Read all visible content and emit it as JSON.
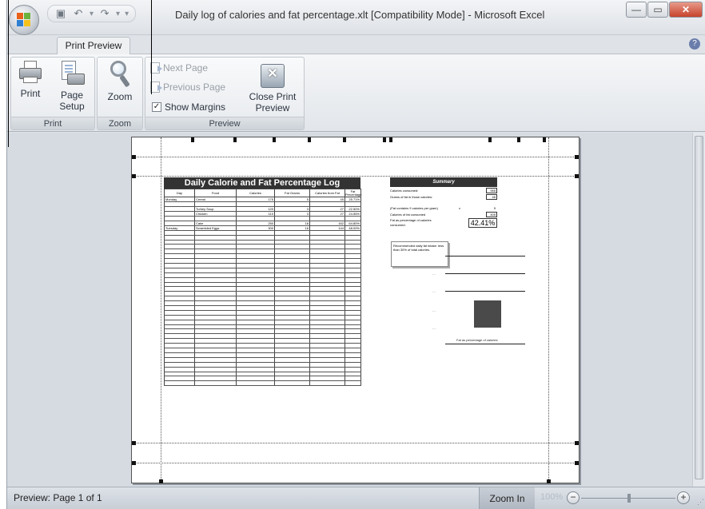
{
  "window": {
    "title": "Daily log of calories and fat percentage.xlt  [Compatibility Mode] - Microsoft Excel"
  },
  "ribbon": {
    "active_tab": "Print Preview",
    "groups": {
      "print": {
        "label": "Print",
        "print_label": "Print",
        "page_setup_line1": "Page",
        "page_setup_line2": "Setup"
      },
      "zoom": {
        "label": "Zoom",
        "zoom_label": "Zoom"
      },
      "preview": {
        "label": "Preview",
        "next_page": "Next Page",
        "previous_page": "Previous Page",
        "show_margins": "Show Margins",
        "show_margins_checked": true,
        "close_line1": "Close Print",
        "close_line2": "Preview"
      }
    }
  },
  "sheet": {
    "log_title": "Daily Calorie and Fat Percentage Log",
    "headers": [
      "Day",
      "Food",
      "Calories",
      "Fat Grams",
      "Calories from Fat",
      "Fat Percentage"
    ],
    "rows": [
      [
        "Monday",
        "Cereal",
        "175",
        "5",
        "45",
        "25.71%"
      ],
      [
        "",
        "",
        "",
        "",
        "",
        ""
      ],
      [
        "",
        "Turkey Soup",
        "120",
        "3",
        "27",
        "22.50%"
      ],
      [
        "",
        "Chicken",
        "110",
        "3",
        "27",
        "24.55%"
      ],
      [
        "",
        "",
        "",
        "",
        "",
        ""
      ],
      [
        "",
        "Cake",
        "250",
        "18",
        "162",
        "64.80%"
      ],
      [
        "Tuesday",
        "Scrambled Eggs",
        "300",
        "16",
        "144",
        "48.00%"
      ]
    ],
    "summary": {
      "title": "Summary",
      "calories_consumed_label": "Calories consumed:",
      "calories_consumed_value": "955",
      "fat_grams_label": "Grams of fat in those calories:",
      "fat_grams_value": "45",
      "fat_note_label": "(Fat contains 9 calories per gram)",
      "fat_note_x": "x",
      "fat_note_value": "9",
      "fat_calories_label": "Calories of fat consumed",
      "fat_calories_value": "405",
      "fat_pct_label_line1": "Fat as percentage of calories",
      "fat_pct_label_line2": "consumed:",
      "fat_pct_value": "42.41%",
      "tip": "Recommended daily fat intake: less than 30% of total calories."
    },
    "chart": {
      "xlabel": "Fat as percentage of calories"
    }
  },
  "chart_data": {
    "type": "bar",
    "categories": [
      "Fat as percentage of calories"
    ],
    "values": [
      42.41
    ]
  },
  "status": {
    "text": "Preview: Page 1 of 1",
    "zoom_in": "Zoom In",
    "zoom_pct": "100%"
  },
  "colors": {
    "ribbon_bg": "#e8ebef",
    "header_fill": "#333333",
    "bar_fill": "#4a4a4a"
  }
}
